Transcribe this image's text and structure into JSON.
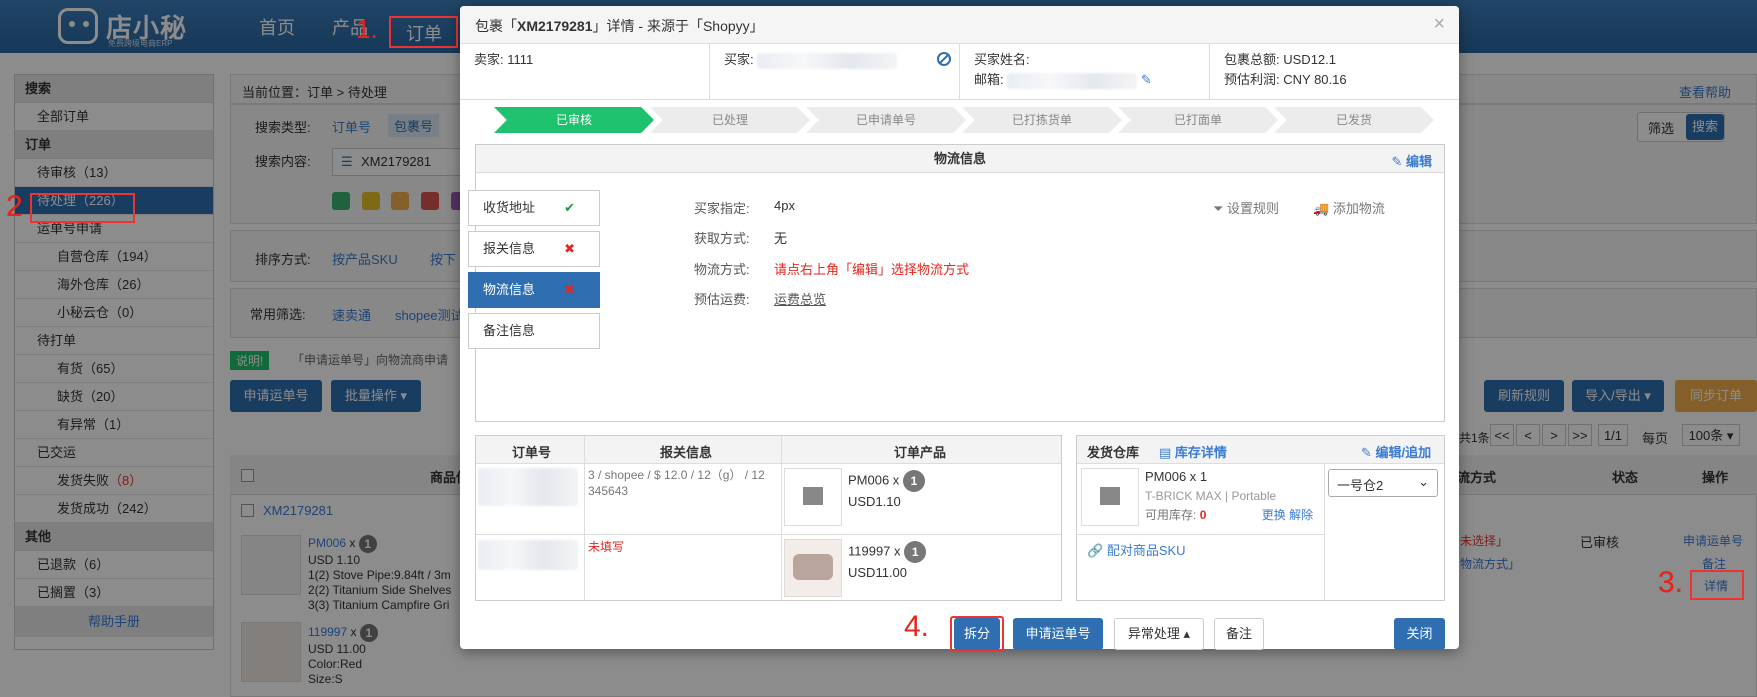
{
  "topbar": {
    "logo_name": "店小秘",
    "logo_tagline": "免费跨境电商ERP",
    "nav": [
      "首页",
      "产品",
      "订单"
    ],
    "mark1": "1."
  },
  "sidebar": {
    "search_header": "搜索",
    "all_orders": "全部订单",
    "orders_header": "订单",
    "items": [
      {
        "label": "待审核",
        "count": "（13）"
      },
      {
        "label": "待处理",
        "count": "（226）"
      },
      {
        "label": "运单号申请",
        "count": ""
      },
      {
        "label": "自营仓库",
        "count": "（194）"
      },
      {
        "label": "海外仓库",
        "count": "（26）"
      },
      {
        "label": "小秘云仓",
        "count": "（0）"
      },
      {
        "label": "待打单",
        "count": ""
      },
      {
        "label": "有货",
        "count": "（65）"
      },
      {
        "label": "缺货",
        "count": "（20）"
      },
      {
        "label": "有异常",
        "count": "（1）"
      },
      {
        "label": "已交运",
        "count": ""
      },
      {
        "label": "发货失败",
        "count": "（8）"
      },
      {
        "label": "发货成功",
        "count": "（242）"
      }
    ],
    "other_header": "其他",
    "other_items": [
      {
        "label": "已退款",
        "count": "（6）"
      },
      {
        "label": "已搁置",
        "count": "（3）"
      }
    ],
    "help": "帮助手册",
    "mark2": "2"
  },
  "main": {
    "breadcrumb": "当前位置：订单 > 待处理",
    "help_link": "查看帮助",
    "search_type_label": "搜索类型:",
    "search_type_opts": [
      "订单号",
      "包裹号"
    ],
    "search_content_label": "搜索内容:",
    "search_value": "XM2179281",
    "filter_btn": "筛选",
    "search_btn": "搜索",
    "sort_label": "排序方式:",
    "sort_opts": [
      "按产品SKU",
      "按下"
    ],
    "common_filter_label": "常用筛选:",
    "common_filters": [
      "速卖通",
      "shopee测试"
    ],
    "notice_tag": "说明!",
    "notice_text": "「申请运单号」向物流商申请",
    "apply_btn": "申请运单号",
    "batch_btn": "批量操作 ▾",
    "refresh_btn": "刷新规则",
    "import_btn": "导入/导出 ▾",
    "sync_btn": "同步订单",
    "pager": {
      "total": "共1条",
      "btns": [
        "<<",
        "<",
        ">",
        ">>"
      ],
      "page": "1/1",
      "per_label": "每页",
      "per_value": "100条 ▾"
    },
    "table_headers": [
      "商品信",
      "物流方式",
      "状态",
      "操作"
    ],
    "order_no": "XM2179281",
    "row1": {
      "sku": "PM006",
      "x": "x",
      "qty": "1",
      "price": "USD 1.10",
      "lines": [
        "1(2) Stove Pipe:9.84ft / 3m",
        "2(2) Titanium Side Shelves",
        "3(3) Titanium Campfire Gri"
      ]
    },
    "row2": {
      "sku": "119997",
      "x": "x",
      "qty": "1",
      "price": "USD 11.00",
      "lines": [
        "Color:Red",
        "Size:S"
      ]
    },
    "logistics_hint": [
      "未选择」",
      "物流方式」"
    ],
    "status": "已审核",
    "actions": [
      "申请运单号",
      "备注",
      "详情"
    ],
    "mark3": "3."
  },
  "modal": {
    "title_prefix": "包裹「",
    "title_id": "XM2179281",
    "title_suffix": "」详情 - 来源于「Shopyy」",
    "close": "×",
    "seller_label": "卖家:",
    "seller_value": "1111",
    "buyer_label": "买家:",
    "buyer_name_label": "买家姓名:",
    "email_label": "邮箱:",
    "total_label": "包裹总额:",
    "total_value": "USD12.1",
    "profit_label": "预估利润:",
    "profit_value": "CNY 80.16",
    "steps": [
      "已审核",
      "已处理",
      "已申请单号",
      "已打拣货单",
      "已打面单",
      "已发货"
    ],
    "logistics_title": "物流信息",
    "edit": "编辑",
    "tabs": [
      {
        "label": "收货地址",
        "mark": "✔"
      },
      {
        "label": "报关信息",
        "mark": "✖"
      },
      {
        "label": "物流信息",
        "mark": "✖"
      },
      {
        "label": "备注信息",
        "mark": ""
      }
    ],
    "fields": [
      {
        "k": "买家指定:",
        "v": "4px"
      },
      {
        "k": "获取方式:",
        "v": "无"
      },
      {
        "k": "物流方式:",
        "v": "请点右上角「编辑」选择物流方式"
      },
      {
        "k": "预估运费:",
        "v": "运费总览"
      }
    ],
    "set_rule": "设置规则",
    "add_logistics": "添加物流",
    "order_table": {
      "headers": [
        "订单号",
        "报关信息",
        "订单产品"
      ],
      "row1": {
        "customs": "3 / shopee / $ 12.0 / 12（g） / 12 345643",
        "sku": "PM006 x",
        "qty": "1",
        "price": "USD1.10"
      },
      "row2": {
        "customs": "未填写",
        "sku": "119997 x",
        "qty": "1",
        "price": "USD11.00"
      }
    },
    "warehouse": {
      "label": "发货仓库",
      "stock_detail": "库存详情",
      "edit_add": "编辑/追加",
      "product_name": "PM006 x 1",
      "product_desc": "T-BRICK MAX | Portable",
      "stock_label": "可用库存:",
      "stock_value": "0",
      "replace": "更换",
      "unbind": "解除",
      "match_sku": "配对商品SKU",
      "select_value": "一号仓2"
    },
    "buttons": {
      "split": "拆分",
      "apply": "申请运单号",
      "exception": "异常处理 ▴",
      "note": "备注",
      "close": "关闭"
    },
    "mark4": "4."
  },
  "colors": {
    "primary": "#2f6fb1",
    "success": "#1ec16e",
    "danger": "#e5261f",
    "orange": "#f0ad4e"
  },
  "swatches": [
    "#3cb371",
    "#e6c229",
    "#f0ad4e",
    "#d9534f",
    "#9b59b6"
  ]
}
